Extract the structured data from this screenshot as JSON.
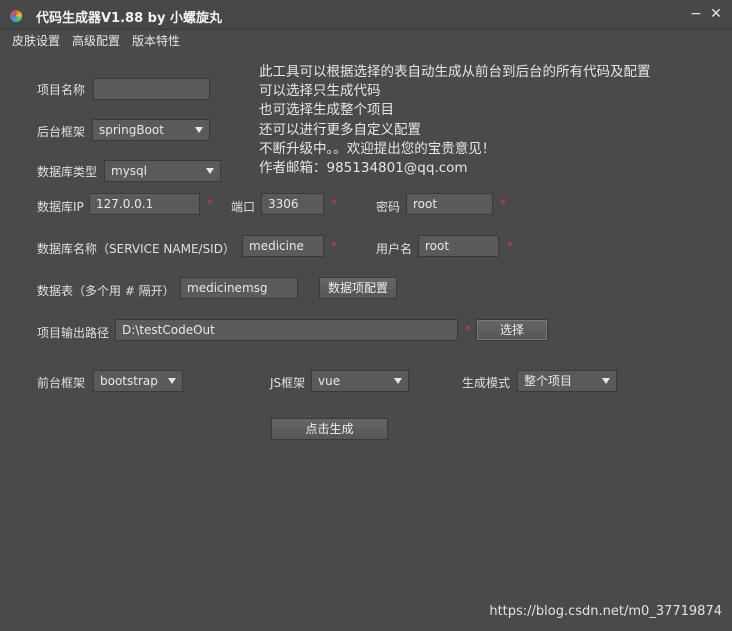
{
  "window": {
    "title": "代码生成器V1.88 by 小螺旋丸",
    "minimize_glyph": "−",
    "close_glyph": "✕"
  },
  "menu": [
    "皮肤设置",
    "高级配置",
    "版本特性"
  ],
  "form": {
    "project_name_label": "项目名称",
    "project_name_value": "",
    "backend_framework_label": "后台框架",
    "backend_framework_value": "springBoot",
    "db_type_label": "数据库类型",
    "db_type_value": "mysql",
    "db_ip_label": "数据库IP",
    "db_ip_value": "127.0.0.1",
    "port_label": "端口",
    "port_value": "3306",
    "password_label": "密码",
    "password_value": "root",
    "db_name_label": "数据库名称（SERVICE NAME/SID）",
    "db_name_value": "medicine",
    "username_label": "用户名",
    "username_value": "root",
    "tables_label": "数据表（多个用 # 隔开）",
    "tables_value": "medicinemsg",
    "data_config_button": "数据项配置",
    "output_path_label": "项目输出路径",
    "output_path_value": "D:\\testCodeOut",
    "choose_button": "选择",
    "frontend_framework_label": "前台框架",
    "frontend_framework_value": "bootstrap",
    "js_framework_label": "JS框架",
    "js_framework_value": "vue",
    "gen_mode_label": "生成模式",
    "gen_mode_value": "整个项目",
    "generate_button": "点击生成",
    "required_mark": "*"
  },
  "info_lines": [
    "此工具可以根据选择的表自动生成从前台到后台的所有代码及配置",
    "可以选择只生成代码",
    "也可选择生成整个项目",
    "还可以进行更多自定义配置",
    "不断升级中。。欢迎提出您的宝贵意见！",
    "作者邮箱：985134801@qq.com"
  ],
  "watermark": "https://blog.csdn.net/m0_37719874"
}
